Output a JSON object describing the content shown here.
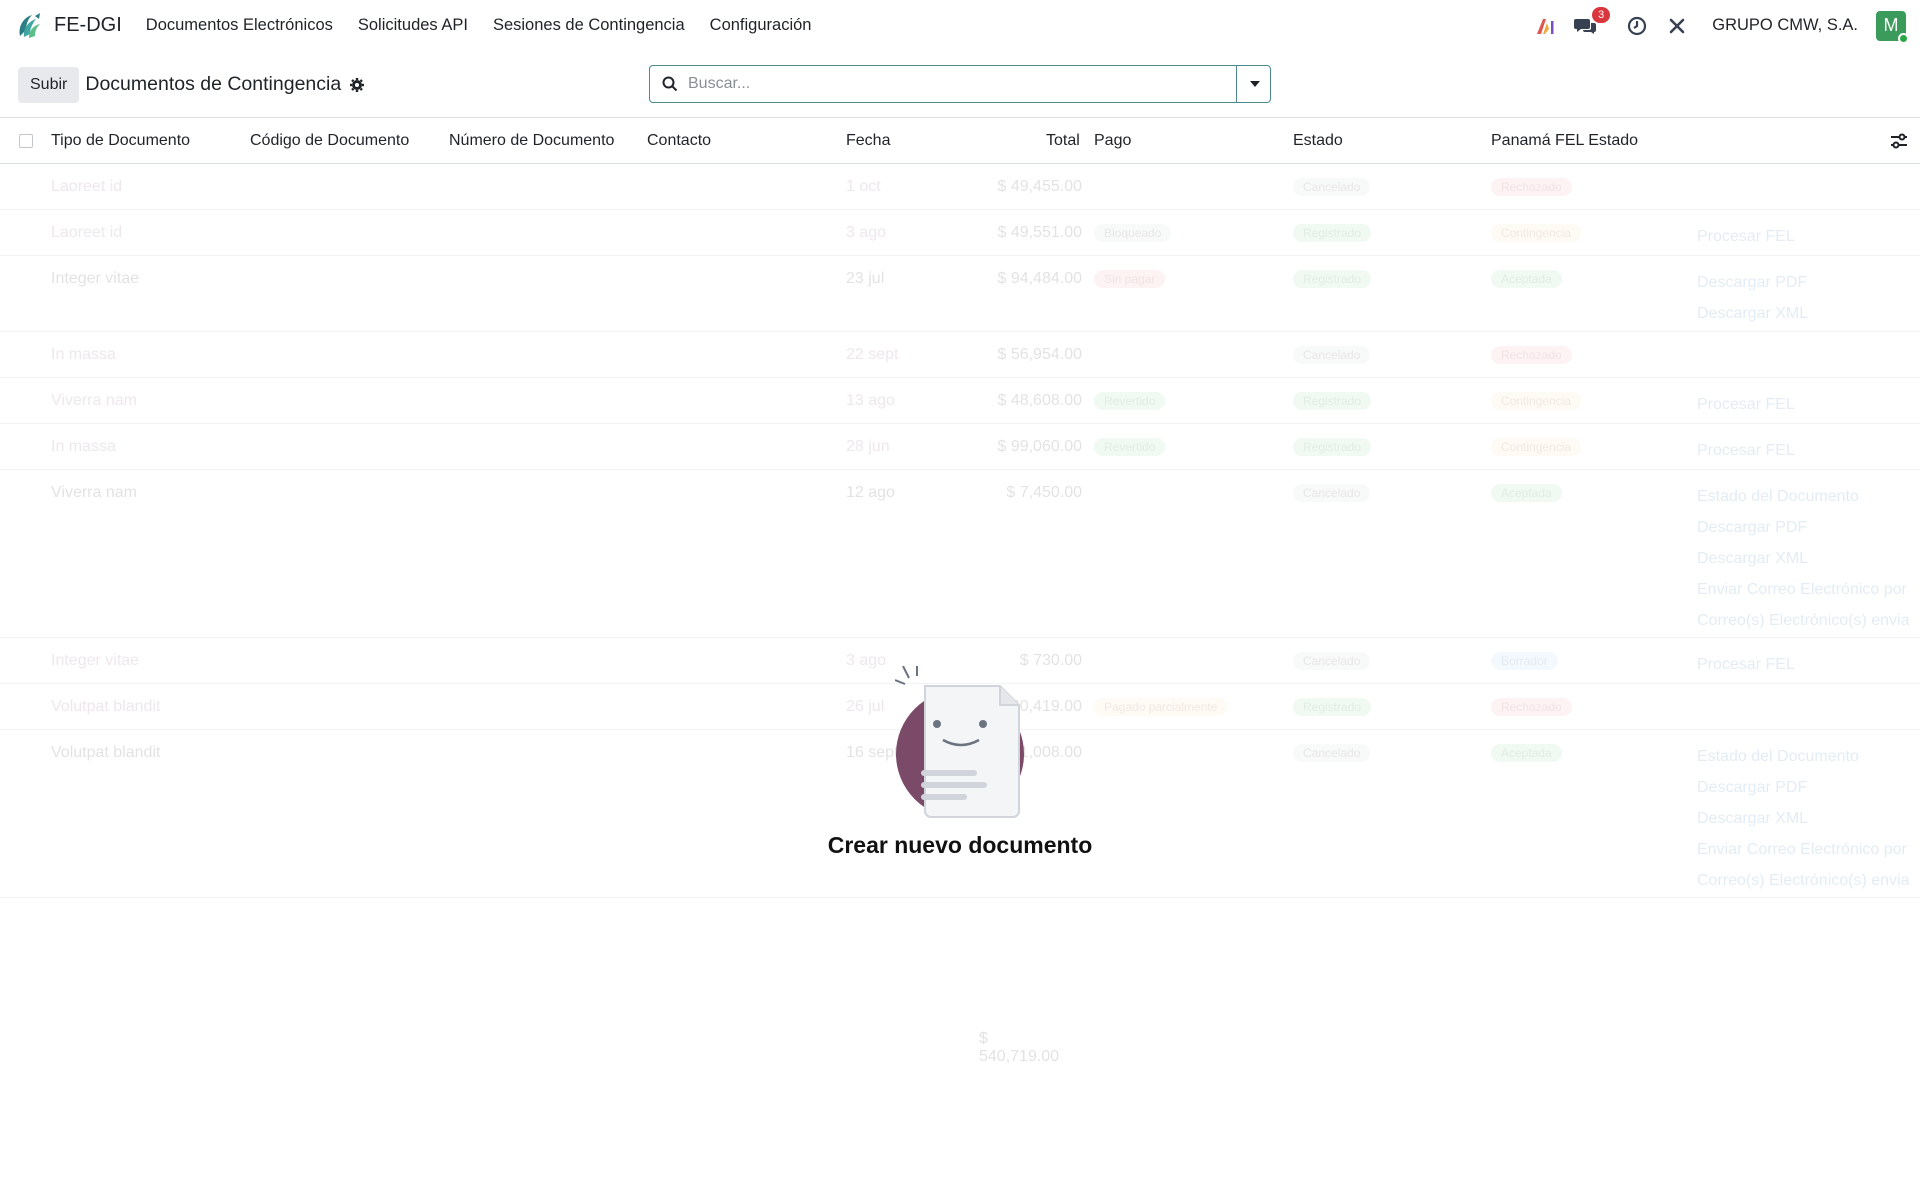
{
  "navbar": {
    "app_name": "FE-DGI",
    "menu": [
      "Documentos Electrónicos",
      "Solicitudes API",
      "Sesiones de Contingencia",
      "Configuración"
    ],
    "chat_badge": "3",
    "company": "GRUPO CMW, S.A.",
    "avatar_letter": "M",
    "colors": {
      "avatar": "#3a9b5a",
      "badge": "#d9363e"
    }
  },
  "control": {
    "upload_label": "Subir",
    "breadcrumb": "Documentos de Contingencia",
    "search_placeholder": "Buscar..."
  },
  "table": {
    "columns": [
      "Tipo de Documento",
      "Código de Documento",
      "Número de Documento",
      "Contacto",
      "Fecha",
      "Total",
      "Pago",
      "Estado",
      "Panamá FEL Estado"
    ],
    "rows": [
      {
        "tipo": "Laoreet id",
        "fecha": "1 oct",
        "total": "$ 49,455.00",
        "pago": "",
        "estado": "Cancelado",
        "fel": "Rechazado",
        "actions": []
      },
      {
        "tipo": "Laoreet id",
        "fecha": "3 ago",
        "total": "$ 49,551.00",
        "pago": "Bloqueado",
        "estado": "Registrado",
        "fel": "Contingencia",
        "actions": [
          "Procesar FEL"
        ]
      },
      {
        "tipo": "Integer vitae",
        "fecha": "23 jul",
        "total": "$ 94,484.00",
        "pago": "Sin pagar",
        "estado": "Registrado",
        "fel": "Aceptada",
        "actions": [
          "Descargar PDF",
          "Descargar XML"
        ]
      },
      {
        "tipo": "In massa",
        "fecha": "22 sept",
        "total": "$ 56,954.00",
        "pago": "",
        "estado": "Cancelado",
        "fel": "Rechazado",
        "actions": []
      },
      {
        "tipo": "Viverra nam",
        "fecha": "13 ago",
        "total": "$ 48,608.00",
        "pago": "Revertido",
        "estado": "Registrado",
        "fel": "Contingencia",
        "actions": [
          "Procesar FEL"
        ]
      },
      {
        "tipo": "In massa",
        "fecha": "28 jun",
        "total": "$ 99,060.00",
        "pago": "Revertido",
        "estado": "Registrado",
        "fel": "Contingencia",
        "actions": [
          "Procesar FEL"
        ]
      },
      {
        "tipo": "Viverra nam",
        "fecha": "12 ago",
        "total": "$ 7,450.00",
        "pago": "",
        "estado": "Cancelado",
        "fel": "Aceptada",
        "actions": [
          "Estado del Documento",
          "Descargar PDF",
          "Descargar XML",
          "Enviar Correo Electrónico por",
          "Correo(s) Electrónico(s) envia"
        ]
      },
      {
        "tipo": "Integer vitae",
        "fecha": "3 ago",
        "total": "$ 730.00",
        "pago": "",
        "estado": "Cancelado",
        "fel": "Borrador",
        "actions": [
          "Procesar FEL"
        ]
      },
      {
        "tipo": "Volutpat blandit",
        "fecha": "26 jul",
        "total": "$ 40,419.00",
        "pago": "Pagado parcialmente",
        "estado": "Registrado",
        "fel": "Rechazado",
        "actions": []
      },
      {
        "tipo": "Volutpat blandit",
        "fecha": "16 sept",
        "total": "$ 31,008.00",
        "pago": "",
        "estado": "Cancelado",
        "fel": "Aceptada",
        "actions": [
          "Estado del Documento",
          "Descargar PDF",
          "Descargar XML",
          "Enviar Correo Electrónico por",
          "Correo(s) Electrónico(s) envia"
        ]
      }
    ],
    "grand_total": "$ 540,719.00"
  },
  "helper": {
    "title": "Crear nuevo documento"
  }
}
